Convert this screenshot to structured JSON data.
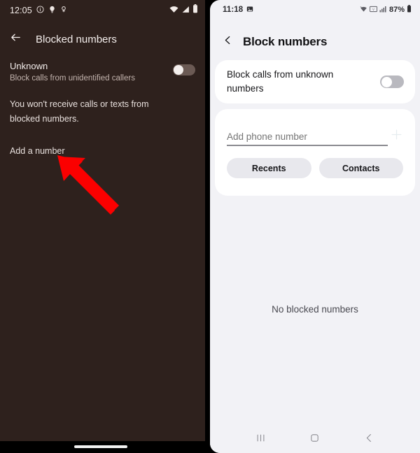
{
  "left_phone": {
    "status_bar": {
      "time": "12:05",
      "icons": [
        "info-circle-icon",
        "lightbulb-icon",
        "location-icon"
      ],
      "right_icons": [
        "wifi-icon",
        "signal-icon",
        "battery-icon"
      ]
    },
    "app_bar": {
      "back_icon": "back-arrow-icon",
      "title": "Blocked numbers"
    },
    "unknown_row": {
      "title": "Unknown",
      "subtitle": "Block calls from unidentified callers",
      "toggle_state": "off"
    },
    "description": "You won't receive calls or texts from blocked numbers.",
    "add_number_label": "Add a number",
    "colors": {
      "background": "#2e211d",
      "text": "#f4eeec",
      "subtext": "#c3b4ae"
    }
  },
  "right_phone": {
    "status_bar": {
      "time": "11:18",
      "icons": [
        "image-icon"
      ],
      "right_icons": [
        "wifi-icon",
        "volte-icon",
        "signal-icon"
      ],
      "battery_percent": "87%"
    },
    "app_bar": {
      "back_icon": "back-chevron-icon",
      "title": "Block numbers"
    },
    "toggle_row": {
      "label": "Block calls from unknown numbers",
      "toggle_state": "off"
    },
    "input_row": {
      "placeholder": "Add phone number",
      "value": "",
      "add_icon": "plus-icon"
    },
    "chips": [
      {
        "label": "Recents"
      },
      {
        "label": "Contacts"
      }
    ],
    "empty_state": "No blocked numbers",
    "nav_bar": {
      "recents_icon": "recents-icon",
      "home_icon": "home-icon",
      "back_icon": "back-icon"
    },
    "colors": {
      "background": "#f2f2f6",
      "card": "#ffffff",
      "text": "#17171a",
      "chip": "#e8e8ed"
    }
  },
  "annotations": {
    "arrow_color": "#fb0000",
    "left_arrow": {
      "points_to": "add-a-number-link"
    },
    "right_arrow": {
      "points_to": "add-phone-number-input"
    }
  }
}
